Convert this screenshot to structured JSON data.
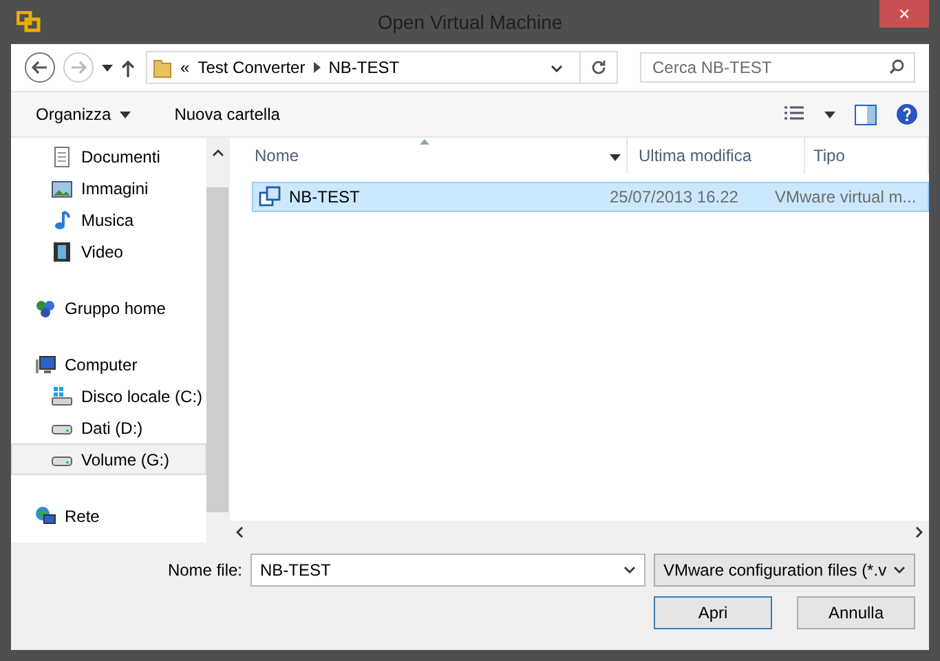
{
  "window": {
    "title": "Open Virtual Machine",
    "close": "✕"
  },
  "address": {
    "overflow": "«",
    "crumbs": [
      "Test Converter",
      "NB-TEST"
    ]
  },
  "search": {
    "placeholder": "Cerca NB-TEST"
  },
  "toolbar": {
    "buttons": [
      "Organizza",
      "Nuova cartella"
    ]
  },
  "sidebar": {
    "sections": [
      {
        "children": [
          {
            "label": "Documenti",
            "kind": "doc",
            "selected": false
          },
          {
            "label": "Immagini",
            "kind": "image",
            "selected": false
          },
          {
            "label": "Musica",
            "kind": "music",
            "selected": false
          },
          {
            "label": "Video",
            "kind": "video",
            "selected": false
          }
        ]
      },
      {
        "label": "Gruppo home",
        "kind": "homegroup",
        "selected": false
      },
      {
        "label": "Computer",
        "kind": "computer",
        "selected": false,
        "children": [
          {
            "label": "Disco locale (C:)",
            "kind": "sysdrive",
            "selected": false
          },
          {
            "label": "Dati (D:)",
            "kind": "drive",
            "selected": false
          },
          {
            "label": "Volume (G:)",
            "kind": "drive",
            "selected": true
          }
        ]
      },
      {
        "label": "Rete",
        "kind": "network",
        "selected": false
      }
    ]
  },
  "table": {
    "columns": [
      "Nome",
      "Ultima modifica",
      "Tipo"
    ],
    "rows": [
      {
        "cells": [
          "NB-TEST",
          "25/07/2013 16.22",
          "VMware virtual m..."
        ],
        "selected": true
      }
    ]
  },
  "footer": {
    "filename_label": "Nome file:",
    "filename": "NB-TEST",
    "filter": "VMware configuration files (*.v",
    "buttons": [
      "Apri",
      "Annulla"
    ]
  }
}
